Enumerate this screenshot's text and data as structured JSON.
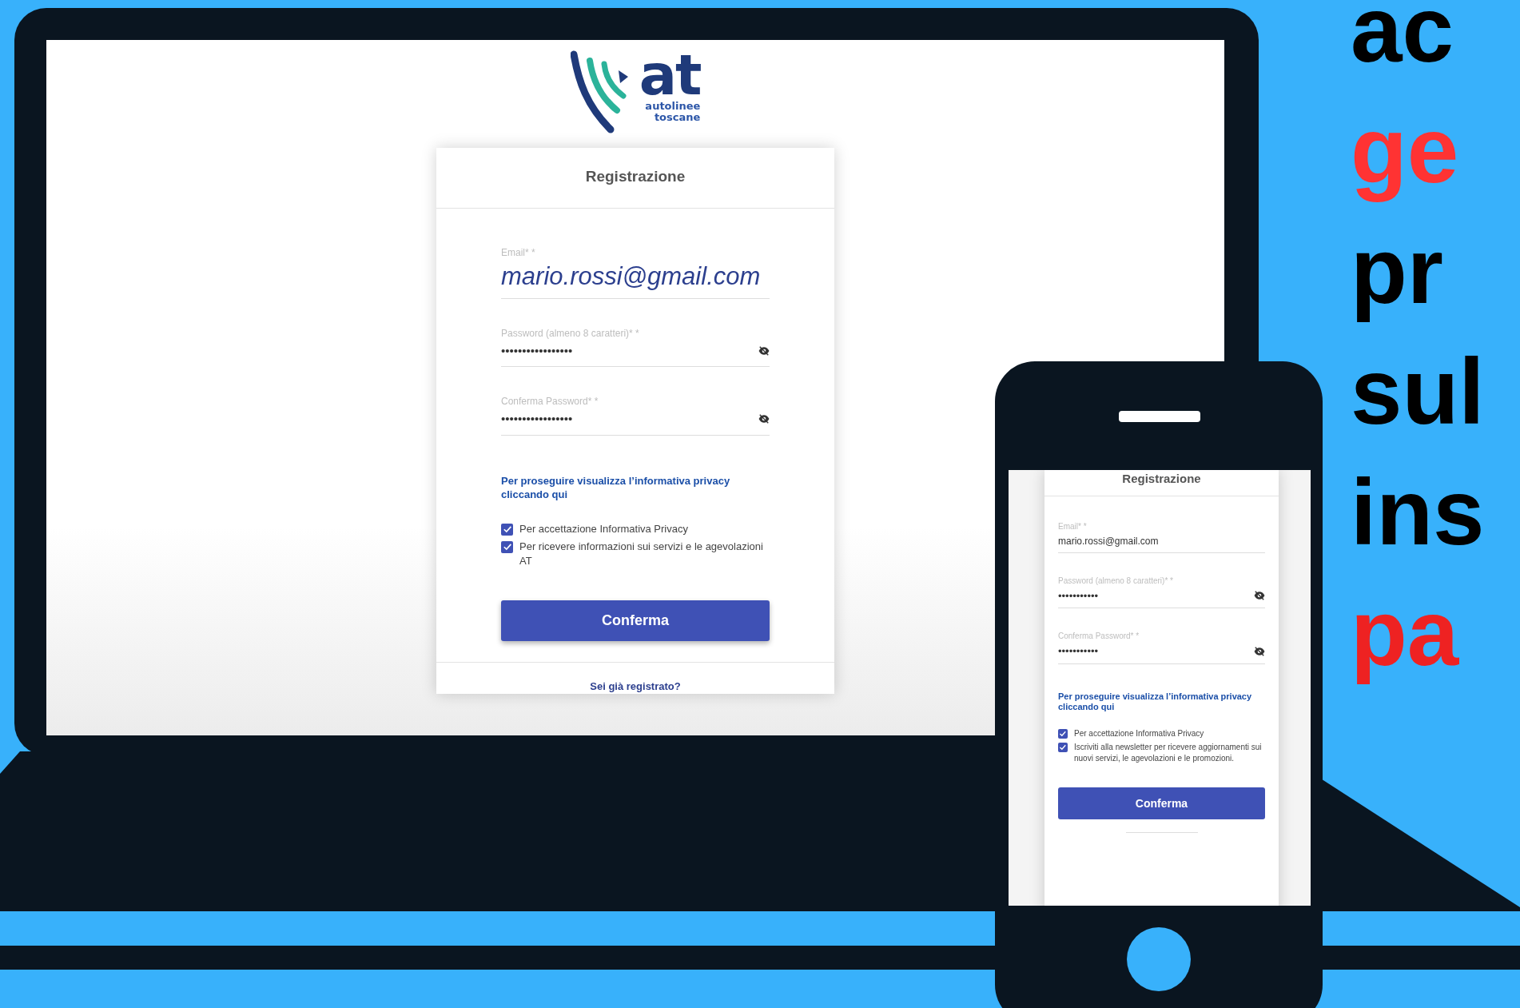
{
  "laptop": {
    "logo": {
      "wordmark": "at",
      "tagline_1": "autolinee",
      "tagline_2": "toscane"
    },
    "form": {
      "title": "Registrazione",
      "fields": [
        {
          "kind": "text",
          "label": "Email* *",
          "value": "mario.rossi@gmail.com"
        },
        {
          "kind": "password",
          "label": "Password (almeno 8 caratteri)* *",
          "value": "•••••••••••••••••"
        },
        {
          "kind": "password",
          "label": "Conferma Password* *",
          "value": "•••••••••••••••••"
        }
      ],
      "privacy_link": "Per proseguire visualizza l’informativa privacy cliccando qui",
      "checkboxes": [
        {
          "label": "Per accettazione Informativa Privacy",
          "checked": true
        },
        {
          "label": "Per ricevere informazioni sui servizi e le agevolazioni AT",
          "checked": true
        }
      ],
      "button": "Conferma",
      "footer_link": "Sei già registrato?"
    }
  },
  "phone": {
    "form": {
      "title": "Registrazione",
      "fields": [
        {
          "kind": "text",
          "label": "Email* *",
          "value": "mario.rossi@gmail.com"
        },
        {
          "kind": "password",
          "label": "Password (almeno 8 caratteri)* *",
          "value": "•••••••••••"
        },
        {
          "kind": "password",
          "label": "Conferma Password* *",
          "value": "•••••••••••"
        }
      ],
      "privacy_link": "Per proseguire visualizza l’informativa privacy cliccando qui",
      "checkboxes": [
        {
          "label": "Per accettazione Informativa Privacy",
          "checked": true
        },
        {
          "label": "Iscriviti alla newsletter per ricevere aggiornamenti sui nuovi servizi, le agevolazioni e le promozioni.",
          "checked": true
        }
      ],
      "button": "Conferma"
    }
  },
  "headline": [
    {
      "text": "ac",
      "color": "#000000"
    },
    {
      "text": "ge",
      "color": "#ff3333"
    },
    {
      "text": "pr",
      "color": "#000000"
    },
    {
      "text": "sul",
      "color": "#000000"
    },
    {
      "text": "ins",
      "color": "#000000"
    },
    {
      "text": "pa",
      "color": "#ee2222"
    }
  ]
}
